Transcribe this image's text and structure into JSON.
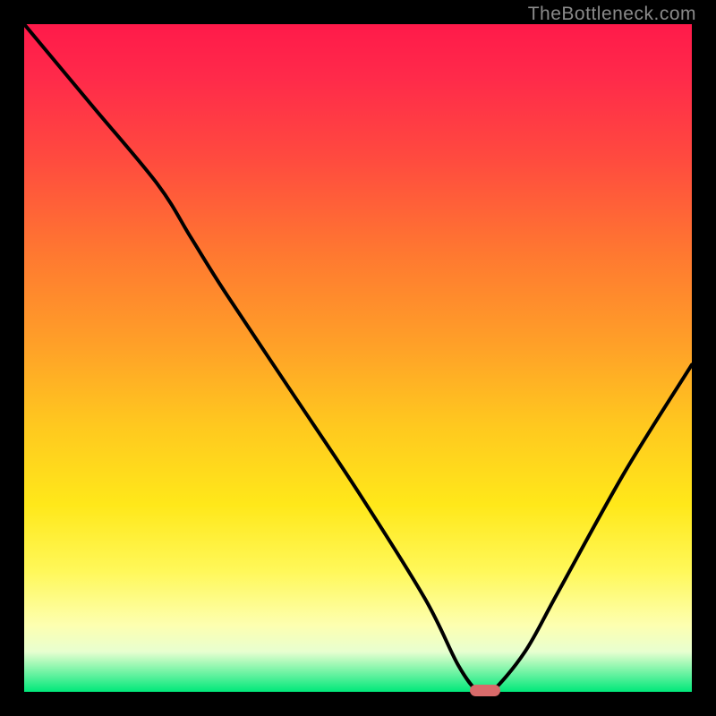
{
  "watermark": "TheBottleneck.com",
  "chart_data": {
    "type": "line",
    "title": "",
    "xlabel": "",
    "ylabel": "",
    "xlim": [
      0,
      100
    ],
    "ylim": [
      0,
      100
    ],
    "series": [
      {
        "name": "curve",
        "x": [
          0,
          10,
          20,
          25,
          30,
          40,
          50,
          60,
          65,
          68,
          70,
          75,
          80,
          90,
          100
        ],
        "y": [
          100,
          88,
          76,
          68,
          60,
          45,
          30,
          14,
          4,
          0,
          0,
          6,
          15,
          33,
          49
        ]
      }
    ],
    "marker": {
      "x": 69,
      "y": 0
    },
    "gradient_stops": [
      {
        "pos": 0,
        "color": "#ff1a4a"
      },
      {
        "pos": 8,
        "color": "#ff2a4a"
      },
      {
        "pos": 20,
        "color": "#ff4a3f"
      },
      {
        "pos": 35,
        "color": "#ff7a30"
      },
      {
        "pos": 48,
        "color": "#ffa028"
      },
      {
        "pos": 60,
        "color": "#ffc81f"
      },
      {
        "pos": 72,
        "color": "#ffe81a"
      },
      {
        "pos": 82,
        "color": "#fff85a"
      },
      {
        "pos": 90,
        "color": "#fdffb0"
      },
      {
        "pos": 94,
        "color": "#e8ffd0"
      },
      {
        "pos": 100,
        "color": "#00e87a"
      }
    ]
  }
}
